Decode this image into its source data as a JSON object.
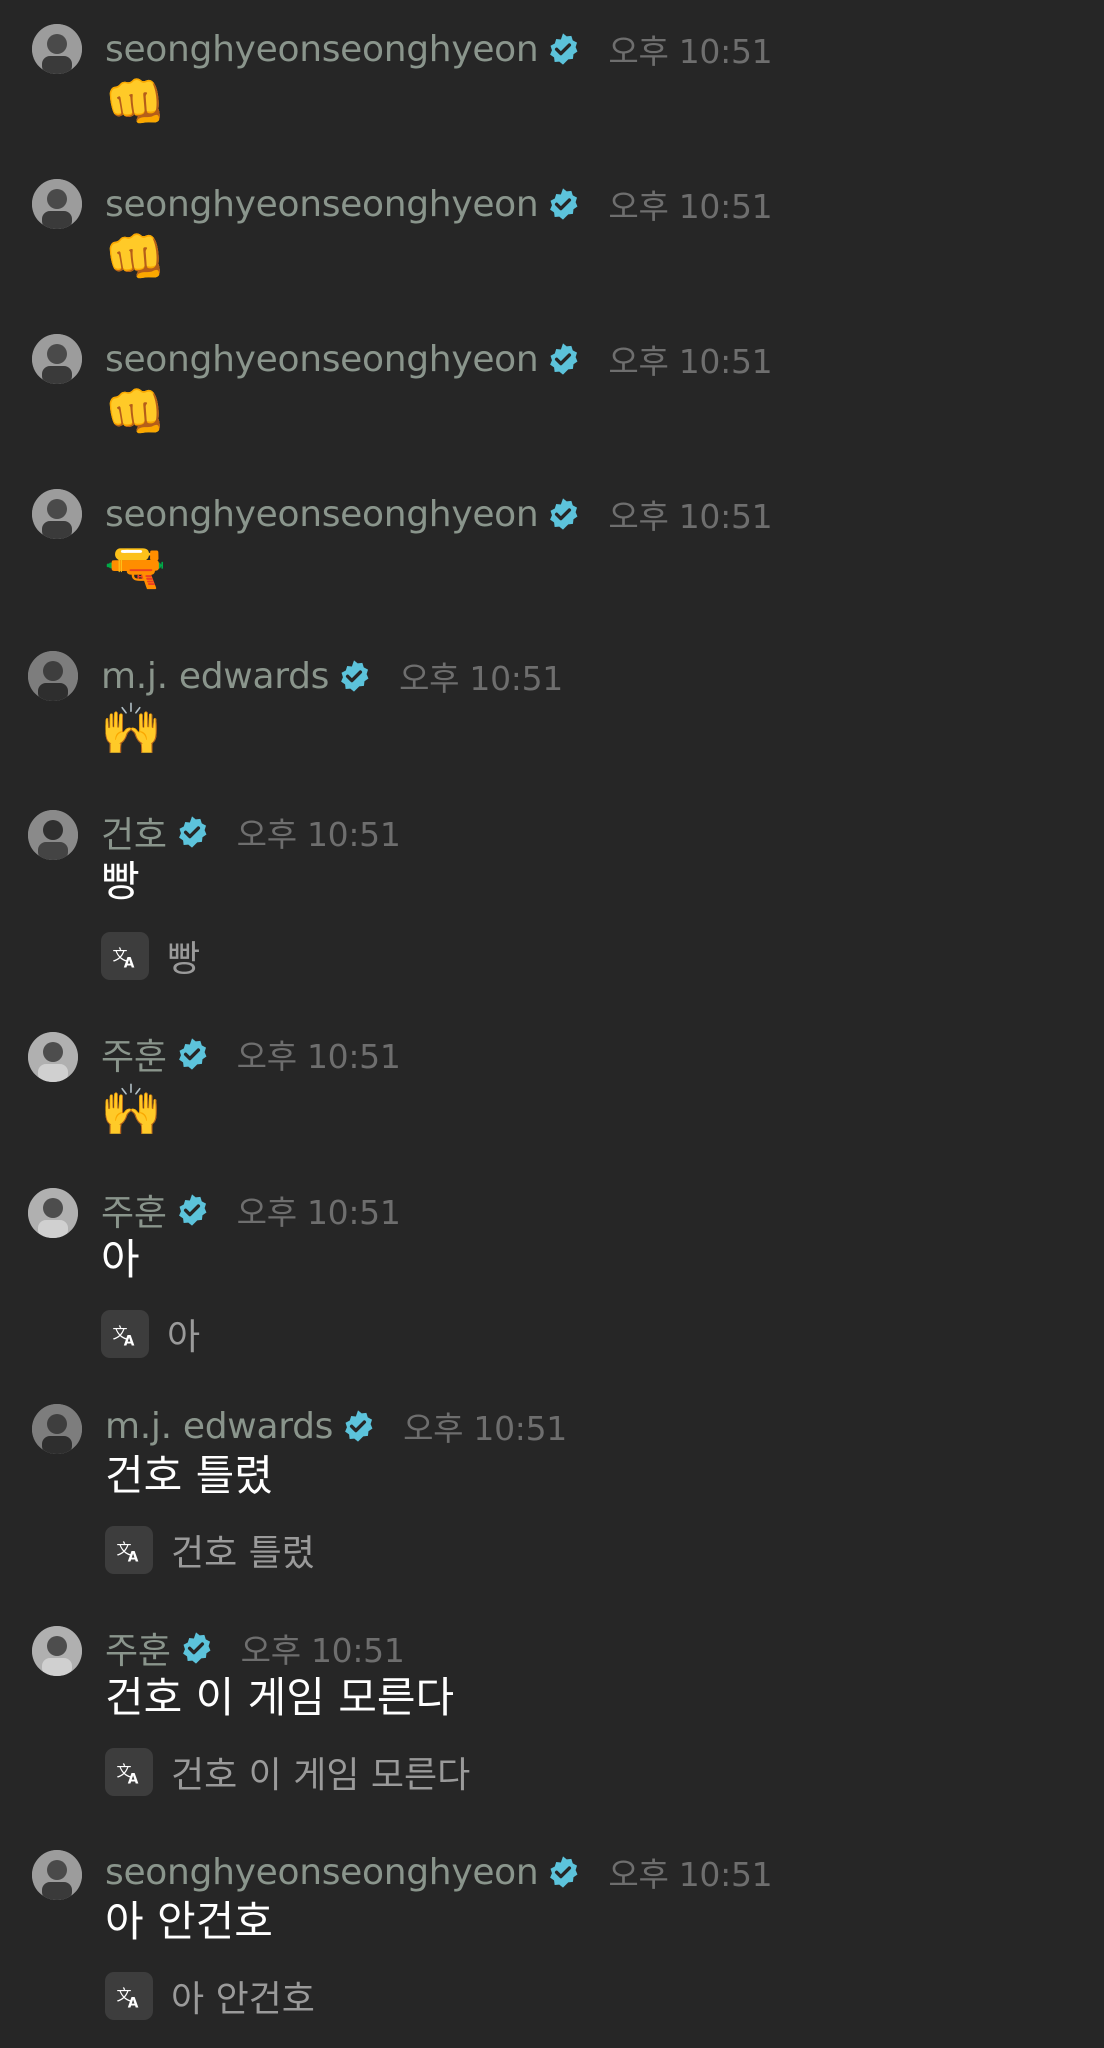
{
  "colors": {
    "background": "#262626",
    "username": "#8a958c",
    "timestamp": "#6e6e6e",
    "message_text": "#ffffff",
    "translation_text": "#9a9a9a",
    "verified_badge": "#5cc3db"
  },
  "messages": [
    {
      "user": "seonghyeonseonghyeon",
      "time": "오후 10:51",
      "emoji": "👊",
      "avatar_icon": "profile-photo"
    },
    {
      "user": "seonghyeonseonghyeon",
      "time": "오후 10:51",
      "emoji": "👊",
      "avatar_icon": "profile-photo"
    },
    {
      "user": "seonghyeonseonghyeon",
      "time": "오후 10:51",
      "emoji": "👊",
      "avatar_icon": "profile-photo"
    },
    {
      "user": "seonghyeonseonghyeon",
      "time": "오후 10:51",
      "emoji": "🔫",
      "avatar_icon": "profile-photo"
    },
    {
      "user": "m.j. edwards",
      "time": "오후 10:51",
      "emoji": "🙌",
      "avatar_icon": "profile-photo"
    },
    {
      "user": "건호",
      "time": "오후 10:51",
      "text": "빵",
      "translation": "빵",
      "avatar_icon": "profile-photo"
    },
    {
      "user": "주훈",
      "time": "오후 10:51",
      "emoji": "🙌",
      "avatar_icon": "profile-photo"
    },
    {
      "user": "주훈",
      "time": "오후 10:51",
      "text": "아",
      "translation": "아",
      "avatar_icon": "profile-photo"
    },
    {
      "user": "m.j. edwards",
      "time": "오후 10:51",
      "text": "건호 틀렸",
      "translation": "건호 틀렸",
      "avatar_icon": "profile-photo"
    },
    {
      "user": "주훈",
      "time": "오후 10:51",
      "text": "건호 이 게임 모른다",
      "translation": "건호 이 게임 모른다",
      "avatar_icon": "profile-photo"
    },
    {
      "user": "seonghyeonseonghyeon",
      "time": "오후 10:51",
      "text": "아 안건호",
      "translation": "아 안건호",
      "avatar_icon": "profile-photo"
    }
  ]
}
